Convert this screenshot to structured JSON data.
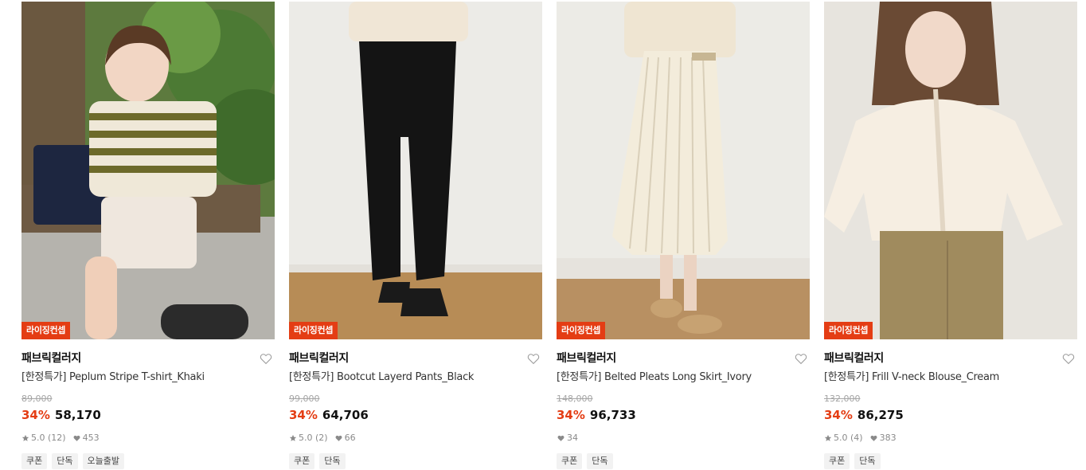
{
  "colors": {
    "accent": "#e43d14",
    "muted": "#a5a5a5",
    "tag_bg": "#f2f2f2"
  },
  "products": [
    {
      "badge": "라이징컨셉",
      "brand": "패브릭컬러지",
      "name": "[한정특가] Peplum Stripe T-shirt_Khaki",
      "original_price": "89,000",
      "discount": "34%",
      "price": "58,170",
      "rating": "5.0",
      "reviews": "(12)",
      "likes": "453",
      "tags": [
        "쿠폰",
        "단독",
        "오늘출발"
      ],
      "image": "woman-striped-polo-outdoor-photo"
    },
    {
      "badge": "라이징컨셉",
      "brand": "패브릭컬러지",
      "name": "[한정특가] Bootcut Layerd Pants_Black",
      "original_price": "99,000",
      "discount": "34%",
      "price": "64,706",
      "rating": "5.0",
      "reviews": "(2)",
      "likes": "66",
      "tags": [
        "쿠폰",
        "단독"
      ],
      "image": "black-bootcut-pants-photo"
    },
    {
      "badge": "라이징컨셉",
      "brand": "패브릭컬러지",
      "name": "[한정특가] Belted Pleats Long Skirt_Ivory",
      "original_price": "148,000",
      "discount": "34%",
      "price": "96,733",
      "likes": "34",
      "tags": [
        "쿠폰",
        "단독"
      ],
      "image": "ivory-pleated-skirt-photo"
    },
    {
      "badge": "라이징컨셉",
      "brand": "패브릭컬러지",
      "name": "[한정특가] Frill V-neck Blouse_Cream",
      "original_price": "132,000",
      "discount": "34%",
      "price": "86,275",
      "rating": "5.0",
      "reviews": "(4)",
      "likes": "383",
      "tags": [
        "쿠폰",
        "단독"
      ],
      "image": "cream-frill-blouse-photo"
    }
  ]
}
